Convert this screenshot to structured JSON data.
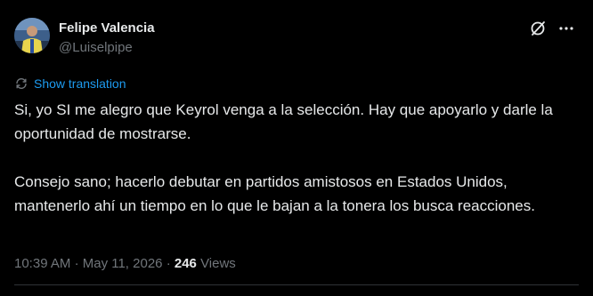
{
  "author": {
    "name": "Felipe Valencia",
    "handle": "@Luiselpipe"
  },
  "actions": {
    "grok_icon": "grok-icon",
    "more_icon": "more-horizontal-icon"
  },
  "translate": {
    "label": "Show translation",
    "icon": "translate-icon"
  },
  "post": {
    "paragraphs": [
      "Si, yo SI me alegro que Keyrol venga a la selección. Hay que apoyarlo y darle la oportunidad de mostrarse.",
      "Consejo sano; hacerlo debutar en partidos amistosos en Estados Unidos, mantenerlo ahí un tiempo en lo que le bajan a la tonera los busca reacciones."
    ]
  },
  "meta": {
    "time": "10:39 AM",
    "separator": "·",
    "date": "May 11, 2026",
    "views_count": "246",
    "views_label": "Views"
  },
  "colors": {
    "background": "#000000",
    "text": "#e7e9ea",
    "secondary": "#71767b",
    "accent": "#1d9bf0",
    "divider": "#2f3336"
  }
}
